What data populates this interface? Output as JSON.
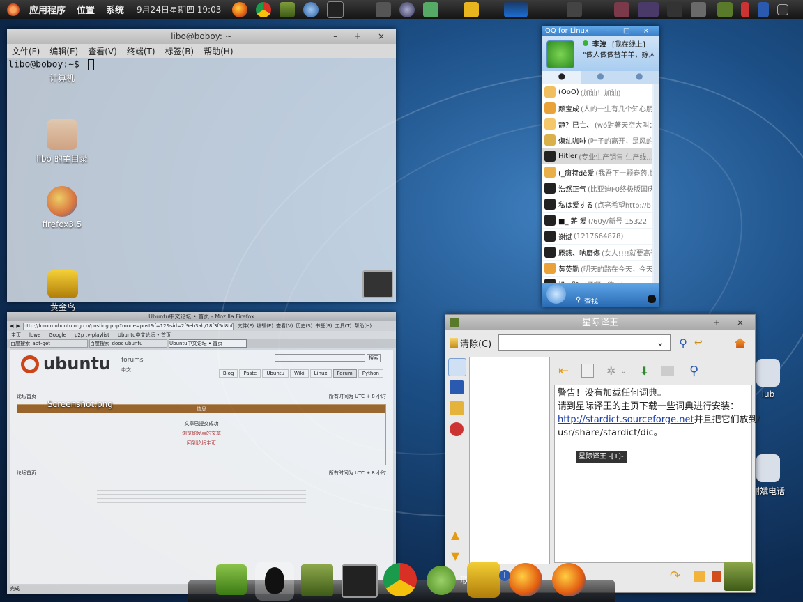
{
  "top_panel": {
    "menus": [
      "应用程序",
      "位置",
      "系统"
    ],
    "clock": "9月24日星期四 19:03"
  },
  "desktop_icons": [
    "计算机",
    "libo 的主目录",
    "firefox3.5",
    "黄金鸟",
    "Screenshot.png",
    "lub",
    "谢斌电话"
  ],
  "terminal": {
    "title": "libo@boboy: ~",
    "menus": [
      "文件(F)",
      "编辑(E)",
      "查看(V)",
      "终端(T)",
      "标签(B)",
      "帮助(H)"
    ],
    "prompt": "libo@boboy:~$"
  },
  "firefox": {
    "title": "Ubuntu中文论坛 • 首页 - Mozilla Firefox",
    "menus": [
      "文件(F)",
      "编辑(E)",
      "查看(V)",
      "历史(S)",
      "书签(B)",
      "工具(T)",
      "帮助(H)"
    ],
    "url": "http://forum.ubuntu.org.cn/posting.php?mode=post&f=12&sid=2f9eb3ab/18f3f5d8bf24",
    "bookmarks": [
      "主页",
      "lowe",
      "Google",
      "p2p tv-playlist",
      "Ubuntu中文论坛 • 首页"
    ],
    "tabs": [
      "百度搜索_apt-get",
      "百度搜索_dooc ubuntu",
      "Ubuntu中文论坛 • 首页"
    ],
    "brand": "ubuntu",
    "brand_sub": "forums",
    "brand_lang": "中文",
    "search_btn": "搜索",
    "nav_tabs": [
      "Blog",
      "Paste",
      "Ubuntu",
      "Wiki",
      "Linux",
      "Forum",
      "Python"
    ],
    "bar_title": "信息",
    "msg1": "文章已提交成功",
    "msg2": "浏览你发表的文章",
    "msg3": "回到论坛主页",
    "board_index": "论坛首页",
    "timezone": "所有时间为 UTC + 8 小时",
    "status": "完成"
  },
  "qq": {
    "title": "QQ for Linux",
    "user_name": "李波",
    "user_status": "[我在线上]",
    "user_sig": "\"做人做做替羊羊，嫁人",
    "search_label": "查找",
    "contacts": [
      {
        "name": "(OoO)",
        "sig": "(加油！加油)"
      },
      {
        "name": "颜宝成",
        "sig": "(人的一生有几个知心朋友"
      },
      {
        "name": "静？已亡、",
        "sig": "(wó對著天空大叫：..."
      },
      {
        "name": "傷糺咖啡",
        "sig": "(叶子的离开，是风的？"
      },
      {
        "name": "Hitler",
        "sig": "(专业生产销售 生产线..."
      },
      {
        "name": "(_瘸特dē爱",
        "sig": "(我吾下一颗春药,世"
      },
      {
        "name": "浩然正气",
        "sig": "(比亚迪F0终极版国庆"
      },
      {
        "name": "私は爱する",
        "sig": "(点亮希望http://b1"
      },
      {
        "name": "■_ 薪 爱",
        "sig": "(/60y/新号 15322"
      },
      {
        "name": "谢斌",
        "sig": "(1217664878)"
      },
      {
        "name": "原錶、呐麼傷",
        "sig": "(女人!!!!就要高姿"
      },
      {
        "name": "黄英勤",
        "sig": "(明天的路在今天，今天的"
      },
      {
        "name": "沿...路ﻩ",
        "sig": "(牙啊...嗨...)"
      }
    ]
  },
  "stardict": {
    "title": "星际译王",
    "clear_label": "清除(C)",
    "search_value": "",
    "warning": "警告！没有加载任何词典。",
    "line2": "请到星际译王的主页下载一些词典进行安装：",
    "link": "http://stardict.sourceforge.net",
    "line3_suffix": "并且把它们放到/",
    "line4": "usr/share/stardict/dic。",
    "tooltip": "星际译王 -[1]-"
  },
  "dock": {
    "partial_label": "取"
  }
}
